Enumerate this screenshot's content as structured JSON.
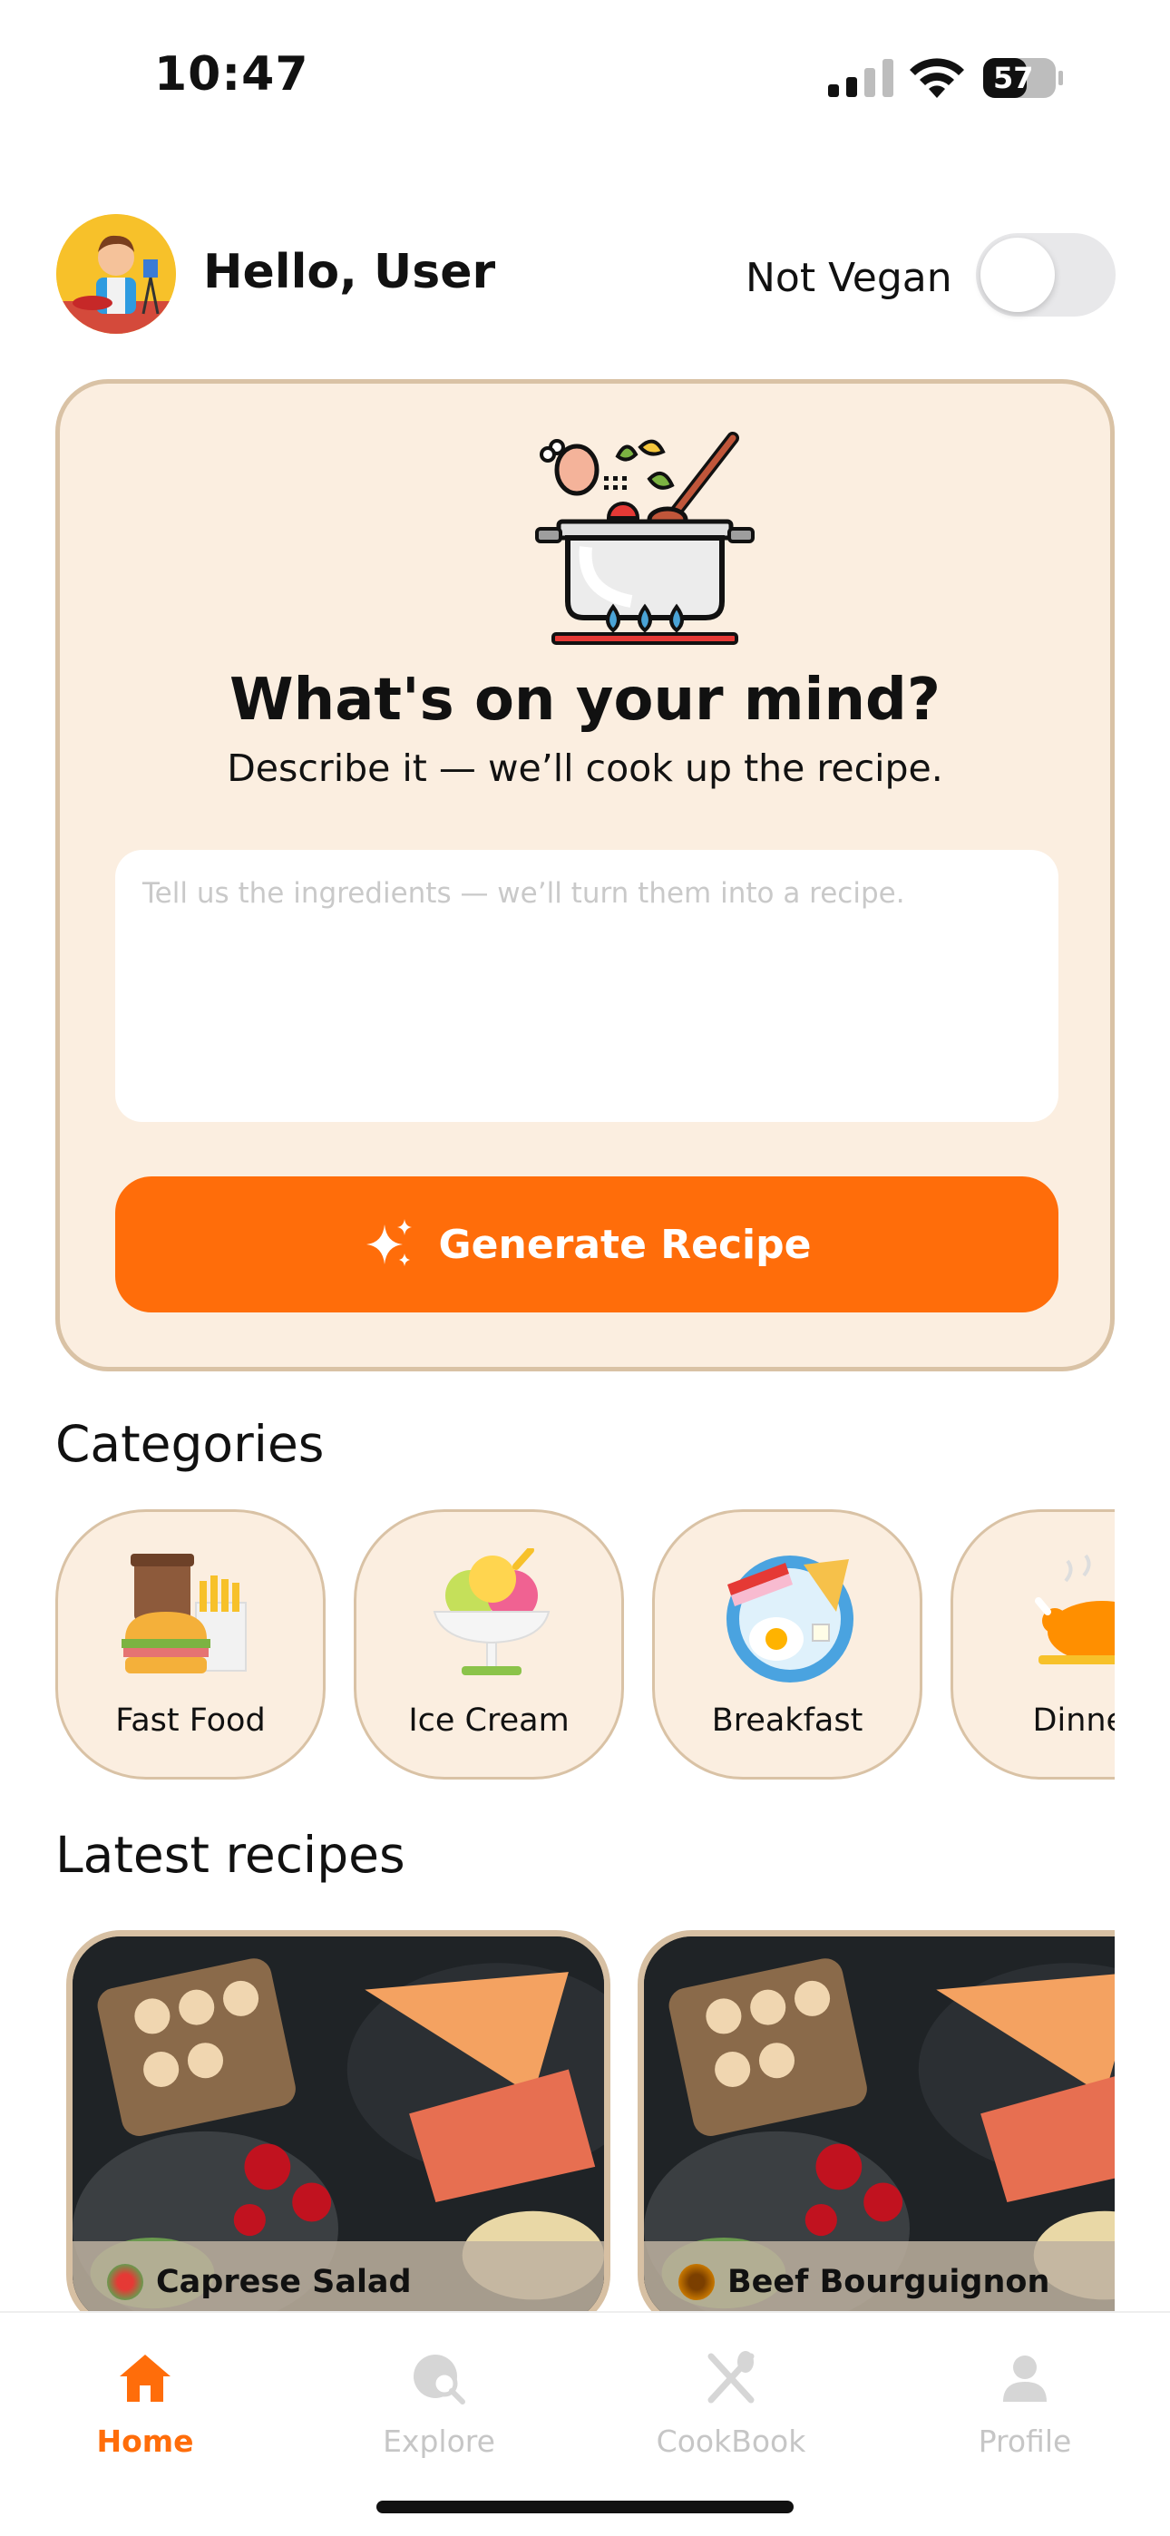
{
  "status_bar": {
    "time": "10:47",
    "battery": "57"
  },
  "header": {
    "greeting": "Hello, User",
    "vegan_label": "Not Vegan",
    "vegan_on": false
  },
  "prompt_card": {
    "title": "What's on your mind?",
    "subtitle": "Describe it — we’ll cook up the recipe.",
    "input_placeholder": "Tell us the ingredients — we’ll turn them into a recipe.",
    "input_value": "",
    "button_label": "Generate Recipe"
  },
  "categories": {
    "title": "Categories",
    "items": [
      {
        "label": "Fast Food",
        "icon": "fast-food-icon"
      },
      {
        "label": "Ice Cream",
        "icon": "ice-cream-icon"
      },
      {
        "label": "Breakfast",
        "icon": "breakfast-icon"
      },
      {
        "label": "Dinner",
        "icon": "dinner-icon"
      }
    ]
  },
  "latest": {
    "title": "Latest recipes",
    "items": [
      {
        "label": "Caprese Salad"
      },
      {
        "label": "Beef Bourguignon"
      }
    ]
  },
  "tabs": [
    {
      "label": "Home",
      "icon": "home-icon",
      "active": true
    },
    {
      "label": "Explore",
      "icon": "explore-icon",
      "active": false
    },
    {
      "label": "CookBook",
      "icon": "cookbook-icon",
      "active": false
    },
    {
      "label": "Profile",
      "icon": "profile-icon",
      "active": false
    }
  ],
  "colors": {
    "accent": "#ff6d0a",
    "card_bg": "#fbeee0",
    "card_border": "#d9c2a5",
    "inactive": "#c6c6c6"
  }
}
